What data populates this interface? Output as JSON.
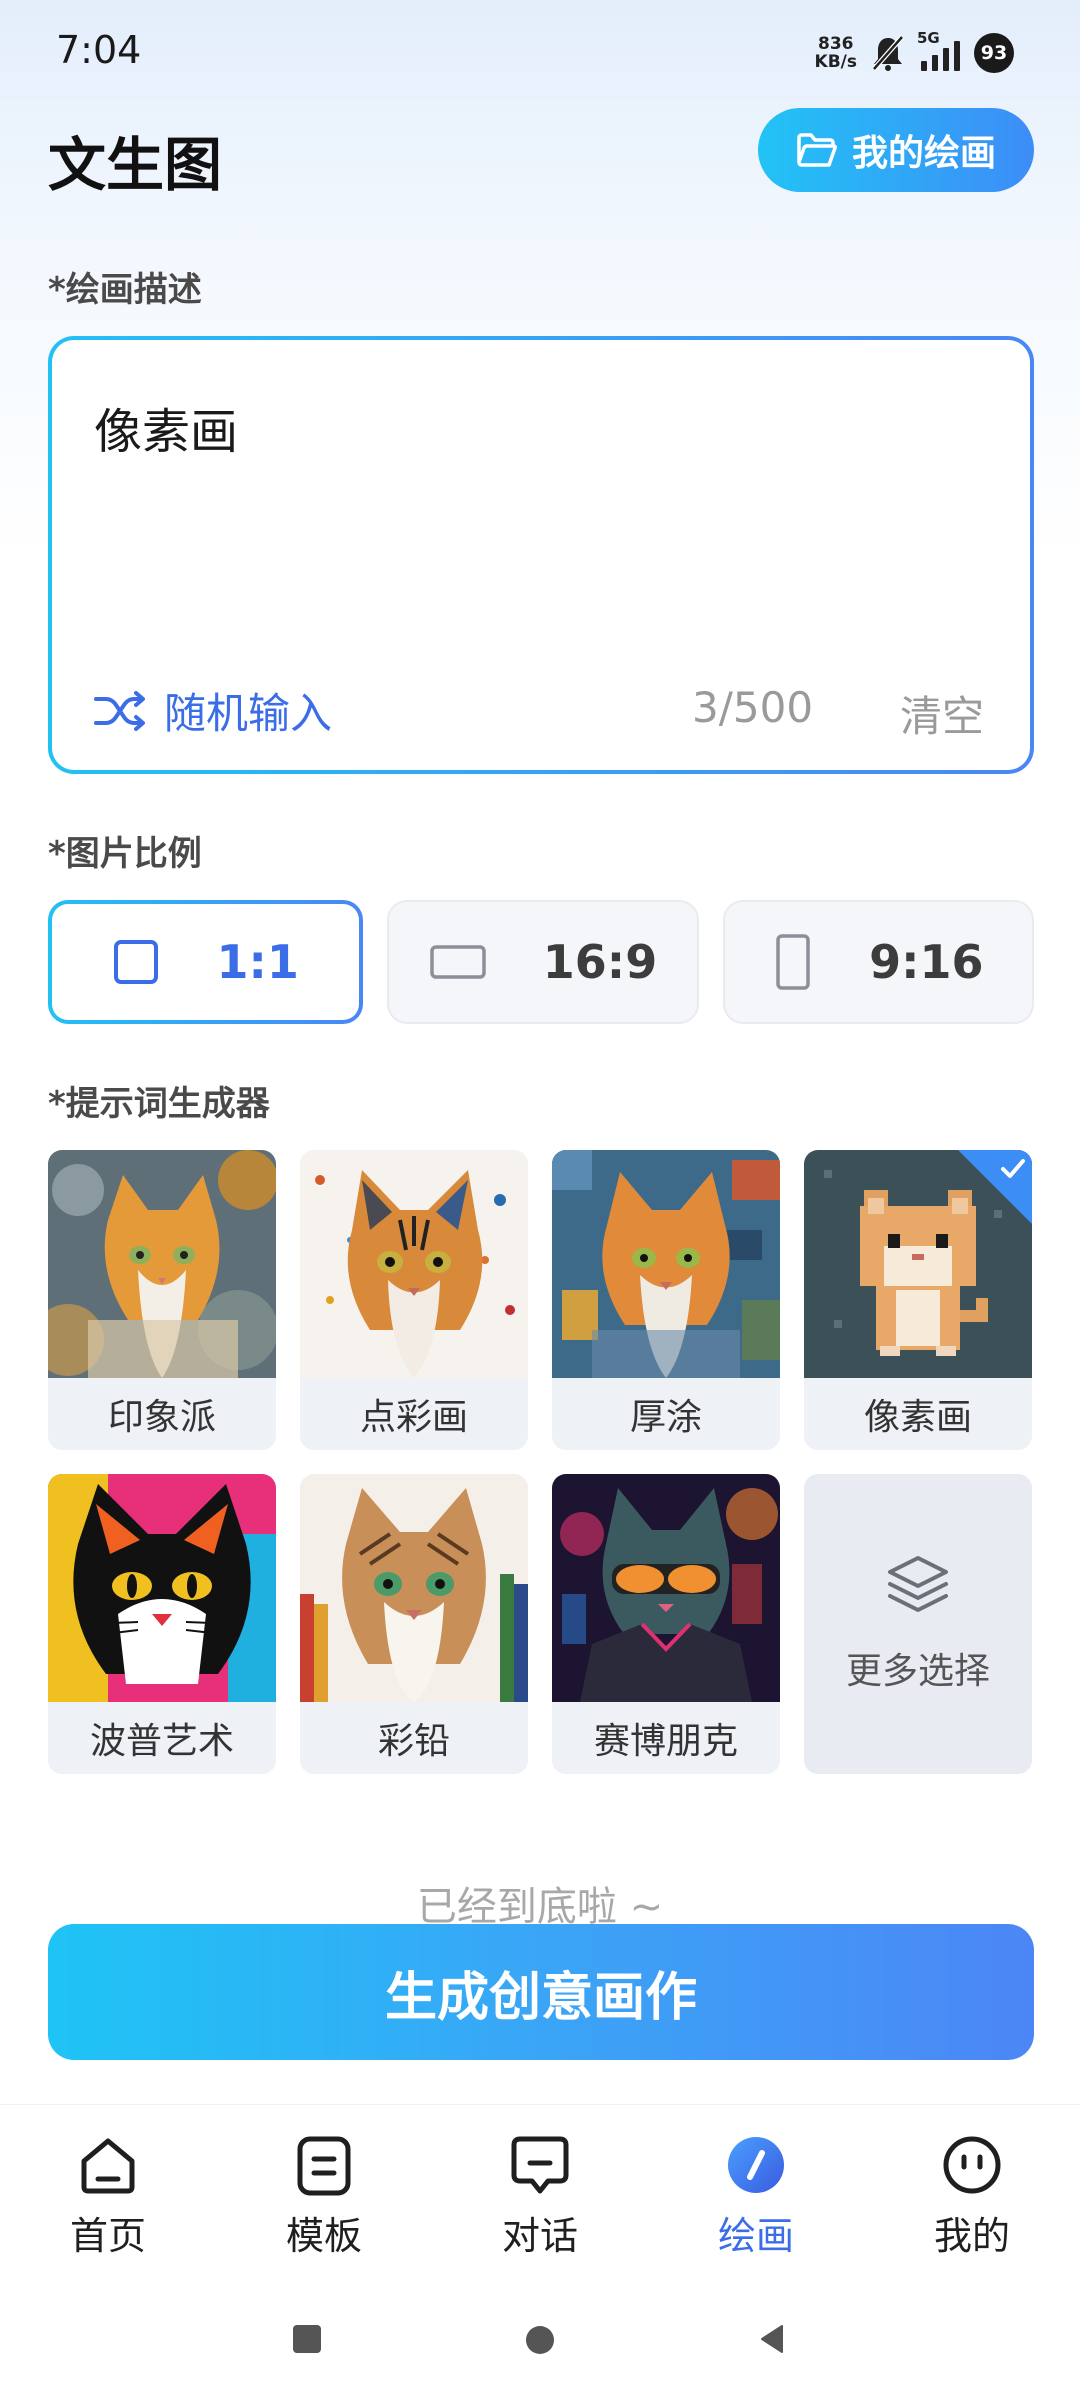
{
  "status_bar": {
    "time": "7:04",
    "net_speed_value": "836",
    "net_speed_unit": "KB/s",
    "signal_label": "5G",
    "battery": "93"
  },
  "header": {
    "title": "文生图",
    "my_drawings_label": "我的绘画"
  },
  "prompt": {
    "section_label": "*绘画描述",
    "value": "像素画",
    "random_label": "随机输入",
    "char_count": "3/500",
    "clear_label": "清空"
  },
  "ratio": {
    "section_label": "*图片比例",
    "options": [
      {
        "label": "1:1",
        "selected": true
      },
      {
        "label": "16:9",
        "selected": false
      },
      {
        "label": "9:16",
        "selected": false
      }
    ]
  },
  "styles": {
    "section_label": "*提示词生成器",
    "items": [
      {
        "label": "印象派",
        "selected": false
      },
      {
        "label": "点彩画",
        "selected": false
      },
      {
        "label": "厚涂",
        "selected": false
      },
      {
        "label": "像素画",
        "selected": true
      },
      {
        "label": "波普艺术",
        "selected": false
      },
      {
        "label": "彩铅",
        "selected": false
      },
      {
        "label": "赛博朋克",
        "selected": false
      }
    ],
    "more_label": "更多选择"
  },
  "bottom_hint": "已经到底啦 ~",
  "generate_label": "生成创意画作",
  "nav": {
    "items": [
      {
        "label": "首页",
        "icon": "home-icon"
      },
      {
        "label": "模板",
        "icon": "template-icon"
      },
      {
        "label": "对话",
        "icon": "chat-icon"
      },
      {
        "label": "绘画",
        "icon": "paint-icon",
        "active": true
      },
      {
        "label": "我的",
        "icon": "profile-icon"
      }
    ]
  },
  "colors": {
    "accent": "#3b6de8",
    "gradient_start": "#1ec4f5",
    "gradient_end": "#4c86f6"
  }
}
